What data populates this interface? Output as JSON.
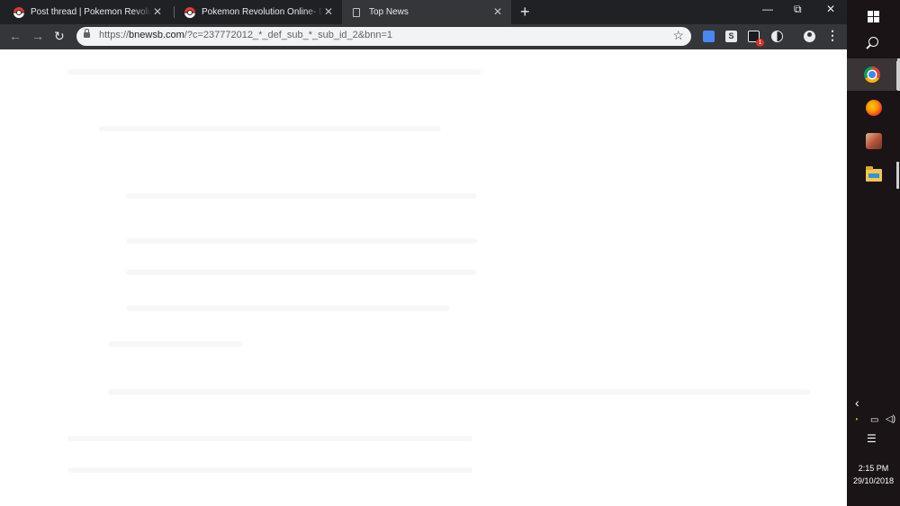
{
  "browser": {
    "tabs": [
      {
        "title": "Post thread | Pokemon Revolution Online",
        "icon": "pokeball-icon",
        "active": false
      },
      {
        "title": "Pokemon Revolution Online- Download",
        "icon": "pokeball-icon",
        "active": false
      },
      {
        "title": "Top News",
        "icon": "document-icon",
        "active": true
      }
    ],
    "close_glyph": "✕",
    "new_tab_glyph": "+",
    "window_controls": {
      "minimize": "—",
      "restore": "⧉",
      "close": "✕"
    },
    "nav": {
      "back": "←",
      "forward": "→",
      "reload": "↻"
    },
    "address": {
      "url_prefix": "https://",
      "url_host": "bnewsb.com",
      "url_path": "/?c=237772012_*_def_sub_*_sub_id_2&bnn=1",
      "bookmark_glyph": "☆"
    },
    "extensions": [
      {
        "name": "translate-extension-icon",
        "label": ""
      },
      {
        "name": "skype-extension-icon",
        "label": "S"
      },
      {
        "name": "pokemon-extension-icon",
        "badge": "1"
      },
      {
        "name": "dark-mode-extension-icon",
        "label": ""
      }
    ],
    "menu_glyph": "⋮"
  },
  "taskbar": {
    "apps": [
      "start-icon",
      "search-icon",
      "chrome-icon",
      "firefox-icon",
      "game-icon",
      "file-explorer-icon"
    ],
    "tray": {
      "expand_glyph": "‹",
      "time": "2:15 PM",
      "date": "29/10/2018"
    }
  }
}
